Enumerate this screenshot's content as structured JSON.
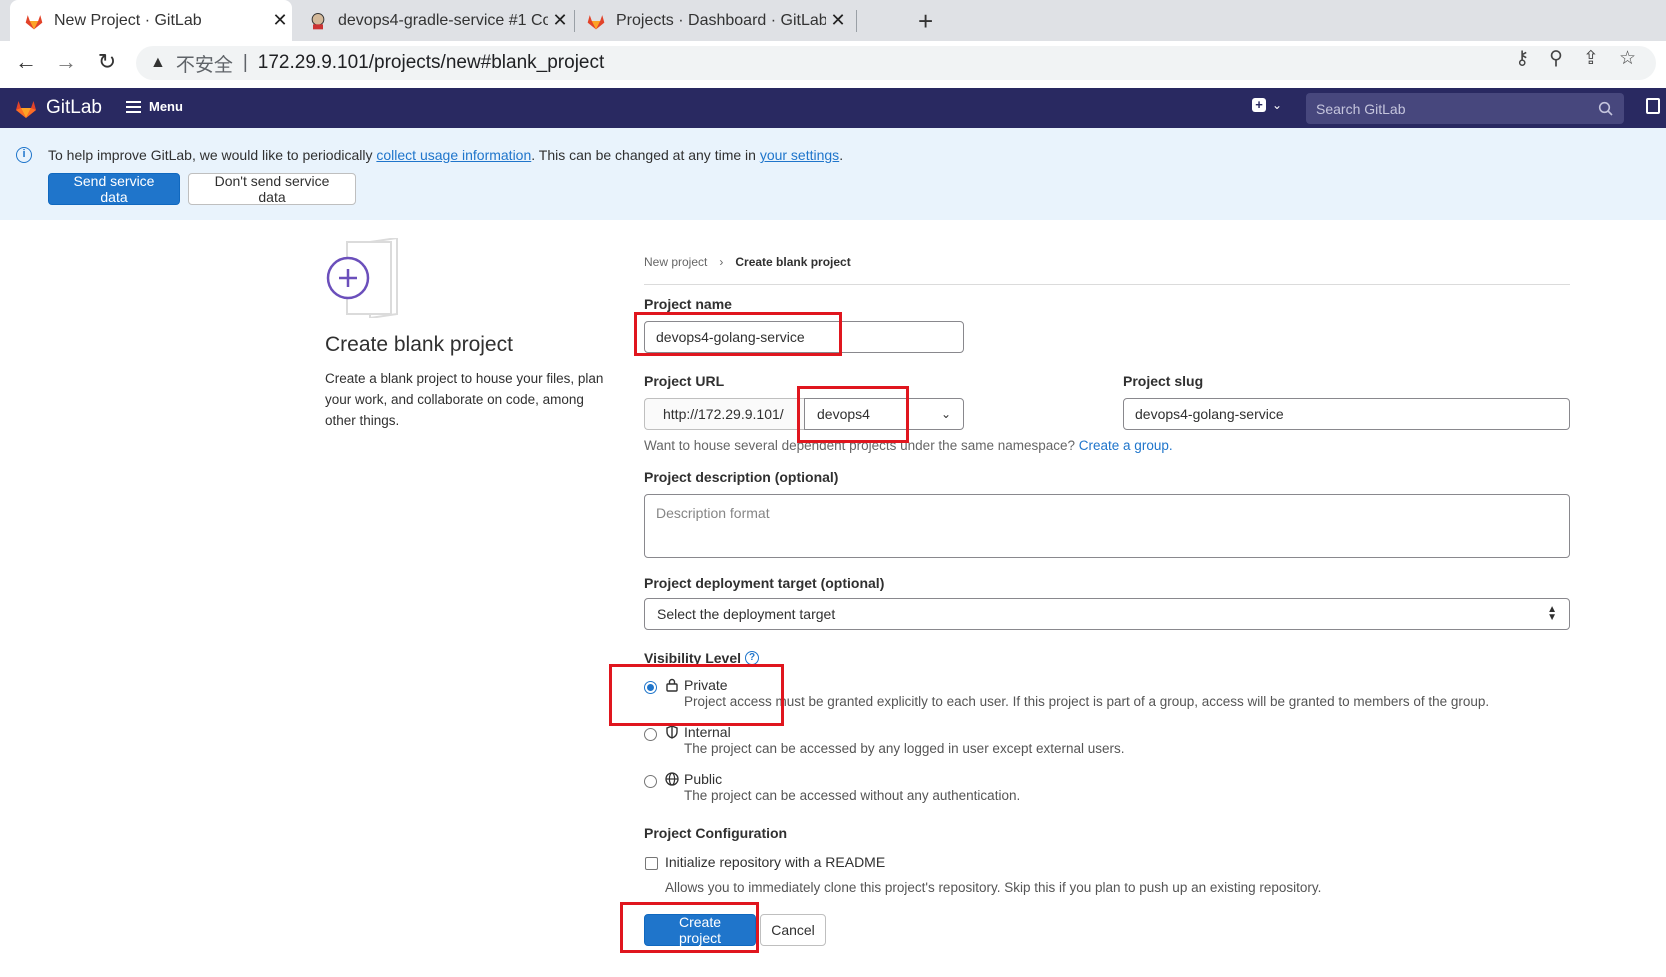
{
  "browser": {
    "tabs": [
      {
        "title": "New Project · GitLab",
        "active": true
      },
      {
        "title": "devops4-gradle-service #1 Co",
        "active": false
      },
      {
        "title": "Projects · Dashboard · GitLab",
        "active": false
      }
    ],
    "close_glyph": "✕",
    "new_tab_glyph": "+",
    "security_label": "不安全",
    "url": "172.29.9.101/projects/new#blank_project"
  },
  "gitlab_nav": {
    "brand": "GitLab",
    "menu_label": "Menu",
    "search_placeholder": "Search GitLab"
  },
  "banner": {
    "text_before": "To help improve GitLab, we would like to periodically ",
    "link1": "collect usage information",
    "text_middle": ". This can be changed at any time in ",
    "link2": "your settings",
    "text_after": ".",
    "send_button": "Send service data",
    "dont_send_button": "Don't send service data"
  },
  "left_panel": {
    "title": "Create blank project",
    "description": "Create a blank project to house your files, plan your work, and collaborate on code, among other things."
  },
  "breadcrumb": {
    "parent": "New project",
    "separator": "›",
    "current": "Create blank project"
  },
  "form": {
    "project_name_label": "Project name",
    "project_name_value": "devops4-golang-service",
    "project_url_label": "Project URL",
    "url_prefix": "http://172.29.9.101/",
    "namespace_value": "devops4",
    "project_slug_label": "Project slug",
    "project_slug_value": "devops4-golang-service",
    "group_help_text": "Want to house several dependent projects under the same namespace? ",
    "group_help_link": "Create a group.",
    "description_label": "Project description (optional)",
    "description_placeholder": "Description format",
    "deployment_label": "Project deployment target (optional)",
    "deployment_value": "Select the deployment target",
    "visibility_label": "Visibility Level",
    "visibility_options": [
      {
        "label": "Private",
        "icon": "lock-icon",
        "checked": true,
        "description": "Project access must be granted explicitly to each user. If this project is part of a group, access will be granted to members of the group."
      },
      {
        "label": "Internal",
        "icon": "shield-icon",
        "checked": false,
        "description": "The project can be accessed by any logged in user except external users."
      },
      {
        "label": "Public",
        "icon": "globe-icon",
        "checked": false,
        "description": "The project can be accessed without any authentication."
      }
    ],
    "config_label": "Project Configuration",
    "readme_label": "Initialize repository with a README",
    "readme_help": "Allows you to immediately clone this project's repository. Skip this if you plan to push up an existing repository.",
    "create_button": "Create project",
    "cancel_button": "Cancel"
  },
  "colors": {
    "navbar": "#292961",
    "primary": "#1f75cb",
    "banner_bg": "#e9f3fc",
    "annotation": "#e0161e"
  }
}
